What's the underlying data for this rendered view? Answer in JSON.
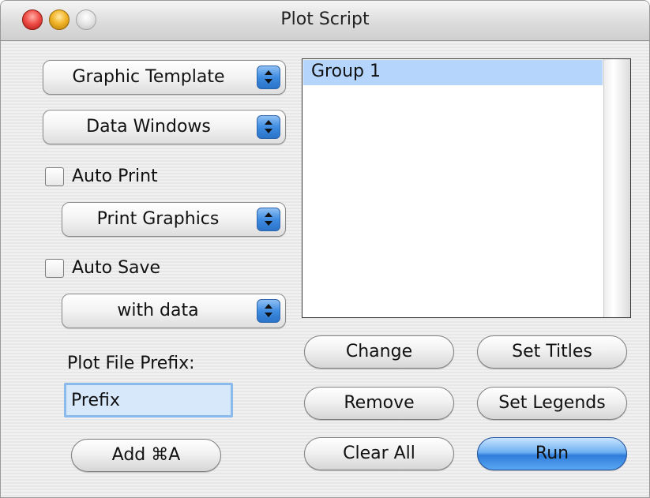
{
  "window": {
    "title": "Plot Script"
  },
  "popups": {
    "template": "Graphic Template",
    "data_windows": "Data Windows",
    "print_graphics": "Print Graphics",
    "save_option": "with data"
  },
  "checkboxes": {
    "auto_print": {
      "label": "Auto Print",
      "checked": false
    },
    "auto_save": {
      "label": "Auto Save",
      "checked": false
    }
  },
  "prefix": {
    "label": "Plot File Prefix:",
    "value": "Prefix"
  },
  "buttons": {
    "add": "Add ⌘A",
    "change": "Change",
    "set_titles": "Set Titles",
    "remove": "Remove",
    "set_legends": "Set Legends",
    "clear_all": "Clear All",
    "run": "Run"
  },
  "groups": {
    "items": [
      "Group 1"
    ],
    "selected_index": 0
  },
  "colors": {
    "selection": "#b6d5fc",
    "default_button": "#2f7ddb"
  }
}
